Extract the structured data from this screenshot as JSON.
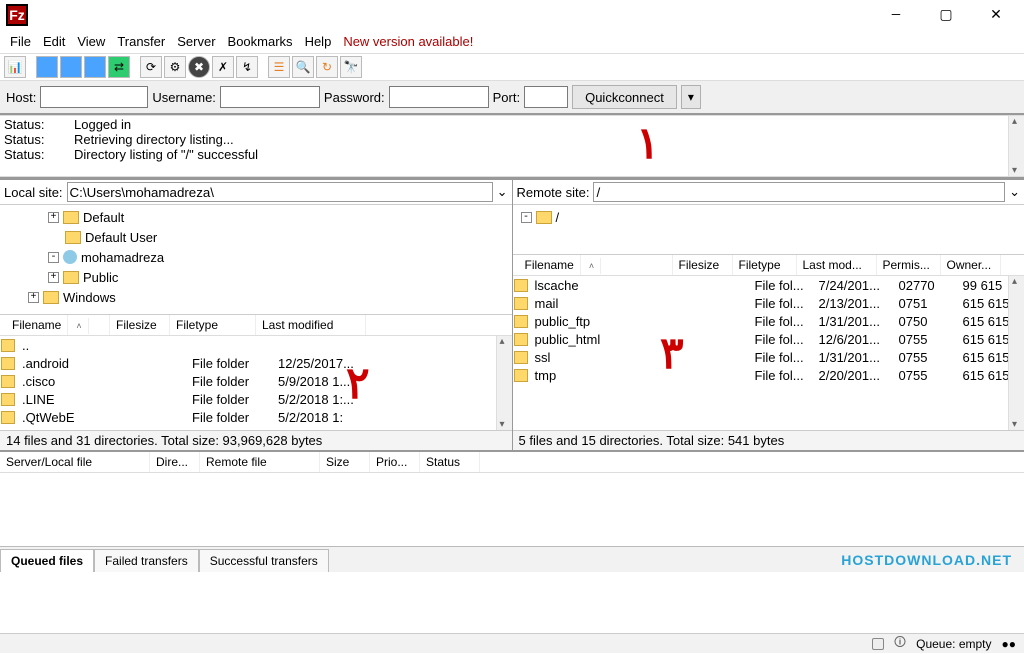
{
  "app_icon": "Fz",
  "menu": [
    "File",
    "Edit",
    "View",
    "Transfer",
    "Server",
    "Bookmarks",
    "Help"
  ],
  "new_version": "New version available!",
  "quickbar": {
    "host_label": "Host:",
    "user_label": "Username:",
    "pass_label": "Password:",
    "port_label": "Port:",
    "quickconnect": "Quickconnect",
    "host": "",
    "user": "",
    "pass": "",
    "port": ""
  },
  "status_log": [
    {
      "label": "Status:",
      "text": "Logged in"
    },
    {
      "label": "Status:",
      "text": "Retrieving directory listing..."
    },
    {
      "label": "Status:",
      "text": "Directory listing of \"/\" successful"
    }
  ],
  "local": {
    "site_label": "Local site:",
    "path": "C:\\Users\\mohamadreza\\",
    "tree": [
      {
        "indent": 0,
        "exp": "+",
        "icon": "fld",
        "name": "Default"
      },
      {
        "indent": 0,
        "exp": "",
        "icon": "fld",
        "name": "Default User"
      },
      {
        "indent": 0,
        "exp": "-",
        "icon": "usr",
        "name": "mohamadreza"
      },
      {
        "indent": 0,
        "exp": "+",
        "icon": "fld",
        "name": "Public"
      },
      {
        "indent": -1,
        "exp": "+",
        "icon": "fld",
        "name": "Windows"
      }
    ],
    "cols": [
      "Filename",
      "Filesize",
      "Filetype",
      "Last modified"
    ],
    "rows": [
      {
        "name": "..",
        "size": "",
        "type": "",
        "mod": ""
      },
      {
        "name": ".android",
        "size": "",
        "type": "File folder",
        "mod": "12/25/2017..."
      },
      {
        "name": ".cisco",
        "size": "",
        "type": "File folder",
        "mod": "5/9/2018 1..."
      },
      {
        "name": ".LINE",
        "size": "",
        "type": "File folder",
        "mod": "5/2/2018 1:..."
      },
      {
        "name": ".QtWebE",
        "size": "",
        "type": "File folder",
        "mod": "5/2/2018 1:"
      }
    ],
    "summary": "14 files and 31 directories. Total size: 93,969,628 bytes"
  },
  "remote": {
    "site_label": "Remote site:",
    "path": "/",
    "tree": [
      {
        "indent": 0,
        "exp": "-",
        "icon": "fld",
        "name": "/"
      }
    ],
    "cols": [
      "Filename",
      "Filesize",
      "Filetype",
      "Last mod...",
      "Permis...",
      "Owner..."
    ],
    "rows": [
      {
        "name": "lscache",
        "size": "",
        "type": "File fol...",
        "mod": "7/24/201...",
        "perm": "02770",
        "owner": "99 615"
      },
      {
        "name": "mail",
        "size": "",
        "type": "File fol...",
        "mod": "2/13/201...",
        "perm": "0751",
        "owner": "615 615"
      },
      {
        "name": "public_ftp",
        "size": "",
        "type": "File fol...",
        "mod": "1/31/201...",
        "perm": "0750",
        "owner": "615 615"
      },
      {
        "name": "public_html",
        "size": "",
        "type": "File fol...",
        "mod": "12/6/201...",
        "perm": "0755",
        "owner": "615 615"
      },
      {
        "name": "ssl",
        "size": "",
        "type": "File fol...",
        "mod": "1/31/201...",
        "perm": "0755",
        "owner": "615 615"
      },
      {
        "name": "tmp",
        "size": "",
        "type": "File fol...",
        "mod": "2/20/201...",
        "perm": "0755",
        "owner": "615 615"
      }
    ],
    "summary": "5 files and 15 directories. Total size: 541 bytes"
  },
  "queue_cols": [
    "Server/Local file",
    "Dire...",
    "Remote file",
    "Size",
    "Prio...",
    "Status"
  ],
  "tabs": [
    "Queued files",
    "Failed transfers",
    "Successful transfers"
  ],
  "watermark": "HOSTDOWNLOAD.NET",
  "queue_status": "Queue: empty",
  "annotations": [
    "۱",
    "۲",
    "۳"
  ]
}
